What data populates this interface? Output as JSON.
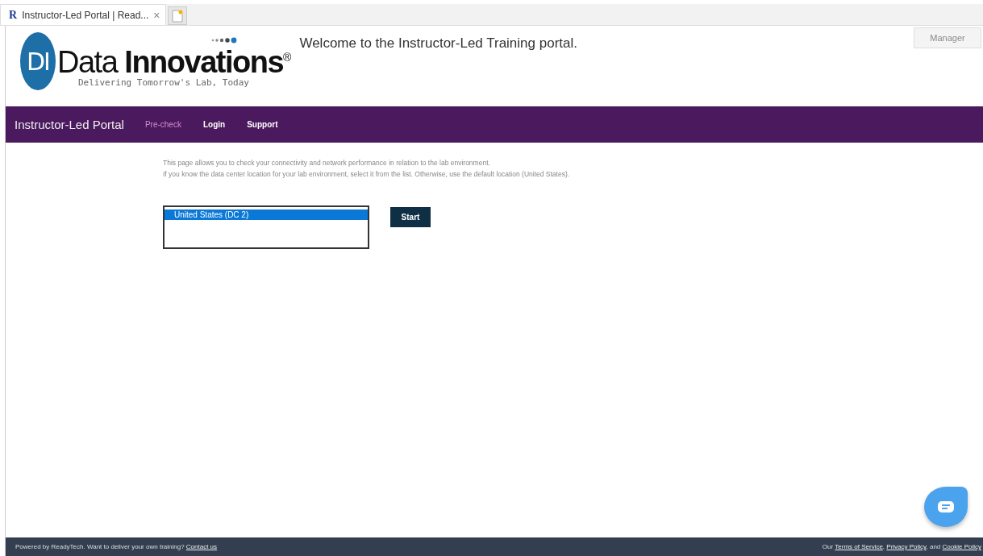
{
  "browser_tab": {
    "icon": "R",
    "title": "Instructor-Led Portal | Read...",
    "close": "×"
  },
  "header": {
    "logo": {
      "mark": "DI",
      "name_light": "Data",
      "name_bold": "Innovations",
      "registered": "®",
      "tagline": "Delivering Tomorrow's Lab, Today"
    },
    "welcome": "Welcome to the Instructor-Led Training portal.",
    "user_button": "Manager"
  },
  "nav": {
    "brand": "Instructor-Led Portal",
    "links": [
      {
        "label": "Pre-check",
        "selected": true
      },
      {
        "label": "Login",
        "selected": false
      },
      {
        "label": "Support",
        "selected": false
      }
    ]
  },
  "intro": [
    "This page allows you to check your connectivity and network performance in relation to the lab environment.",
    "If you know the data center location for your lab environment, select it from the list. Otherwise, use the default location (United States)."
  ],
  "locations": [
    {
      "label": "United States (DC 2)",
      "selected": true
    }
  ],
  "start_button": "Start",
  "footer": {
    "left": [
      {
        "kind": "text",
        "text": "Powered by ReadyTech. Want to deliver your own training? "
      },
      {
        "kind": "link",
        "text": "Contact us"
      }
    ],
    "right": [
      {
        "kind": "text",
        "text": "Our "
      },
      {
        "kind": "link",
        "text": "Terms of Service"
      },
      {
        "kind": "text",
        "text": ", "
      },
      {
        "kind": "link",
        "text": "Privacy Policy"
      },
      {
        "kind": "text",
        "text": ", and "
      },
      {
        "kind": "link",
        "text": "Cookie Policy"
      }
    ]
  }
}
